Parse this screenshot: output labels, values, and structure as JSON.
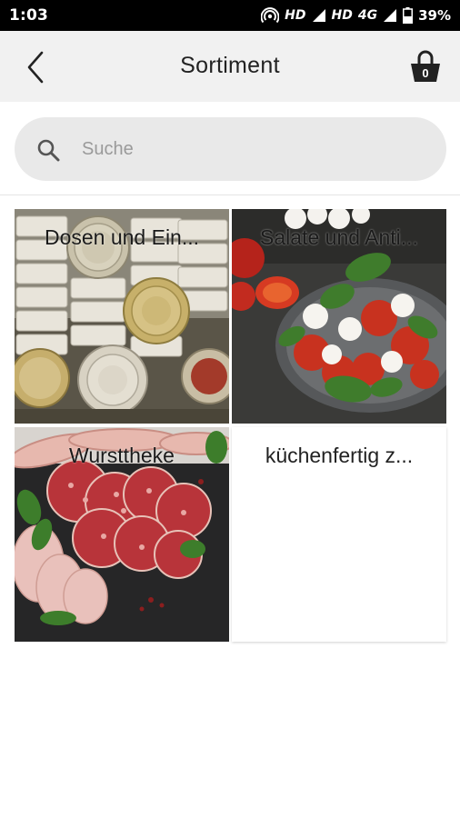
{
  "status_bar": {
    "time": "1:03",
    "network_1": "HD",
    "network_2": "HD",
    "network_type": "4G",
    "battery": "39%"
  },
  "header": {
    "title": "Sortiment",
    "basket_count": "0",
    "icons": {
      "back": "chevron-left-icon",
      "basket": "shopping-basket-icon"
    }
  },
  "search": {
    "placeholder": "Suche",
    "value": "",
    "icon": "search-icon"
  },
  "categories": [
    {
      "label": "Dosen und Ein..."
    },
    {
      "label": "Salate und Anti..."
    },
    {
      "label": "Wursttheke"
    },
    {
      "label": "küchenfertig z..."
    }
  ],
  "colors": {
    "status_bar_bg": "#000000",
    "header_bg": "#f1f1f1",
    "search_bg": "#e9e9e9",
    "page_bg": "#ffffff"
  }
}
